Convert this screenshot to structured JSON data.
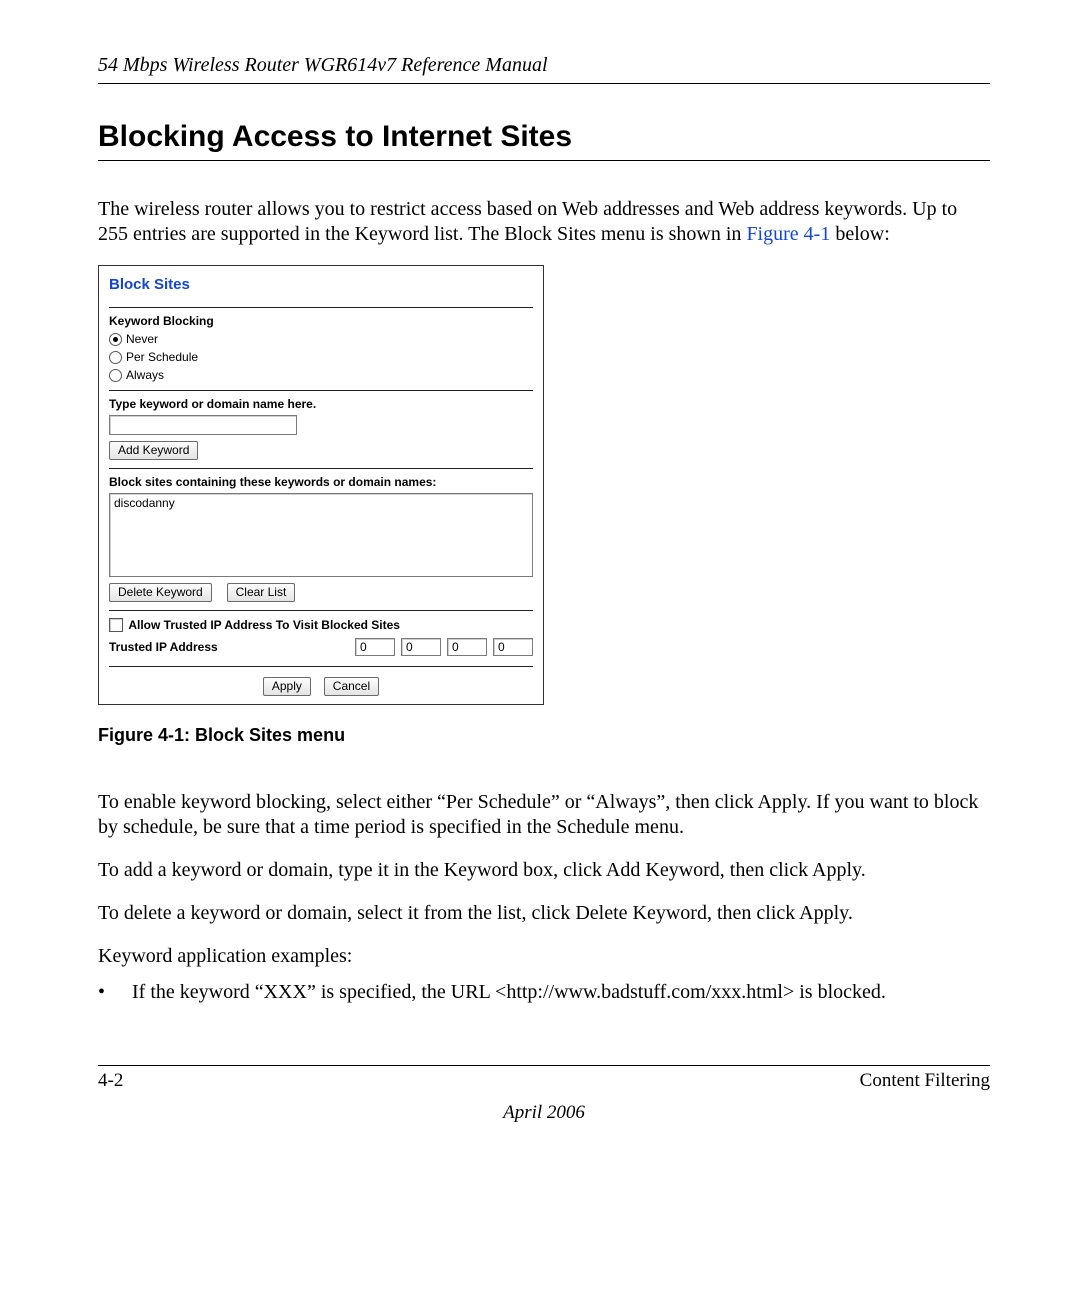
{
  "header": {
    "running": "54 Mbps Wireless Router WGR614v7 Reference Manual"
  },
  "title": "Blocking Access to Internet Sites",
  "intro": {
    "before_ref": "The wireless router allows you to restrict access based on Web addresses and Web address keywords. Up to 255 entries are supported in the Keyword list. The Block Sites menu is shown in ",
    "ref": "Figure 4-1",
    "after_ref": " below:"
  },
  "screenshot": {
    "panel_title": "Block Sites",
    "keyword_blocking_label": "Keyword Blocking",
    "radios": {
      "never": "Never",
      "per_schedule": "Per Schedule",
      "always": "Always",
      "selected": "never"
    },
    "type_label": "Type keyword or domain name here.",
    "add_keyword_btn": "Add Keyword",
    "block_list_label": "Block sites containing these keywords or domain names:",
    "block_list_item": "discodanny",
    "delete_keyword_btn": "Delete Keyword",
    "clear_list_btn": "Clear List",
    "allow_trusted_label": "Allow Trusted IP Address To Visit Blocked Sites",
    "trusted_ip_label": "Trusted IP Address",
    "trusted_ip": {
      "o1": "0",
      "o2": "0",
      "o3": "0",
      "o4": "0"
    },
    "apply_btn": "Apply",
    "cancel_btn": "Cancel"
  },
  "caption": "Figure 4-1:  Block Sites menu",
  "paras": {
    "p1": "To enable keyword blocking, select either “Per Schedule” or “Always”, then click Apply. If you want to block by schedule, be sure that a time period is specified in the Schedule menu.",
    "p2": "To add a keyword or domain, type it in the Keyword box, click Add Keyword, then click Apply.",
    "p3": "To delete a keyword or domain, select it from the list, click Delete Keyword, then click Apply.",
    "p4": "Keyword application examples:"
  },
  "bullet": {
    "dot": "•",
    "text": "If the keyword “XXX” is specified, the URL <http://www.badstuff.com/xxx.html> is blocked."
  },
  "footer": {
    "left": "4-2",
    "right": "Content Filtering",
    "date": "April 2006"
  }
}
